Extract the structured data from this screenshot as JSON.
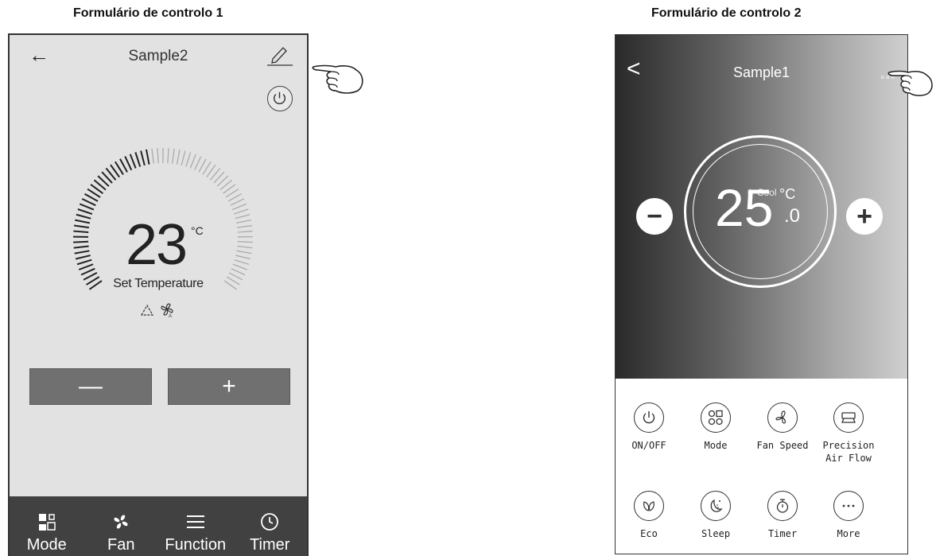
{
  "captions": {
    "form1": "Formulário de controlo 1",
    "form2": "Formulário de controlo 2"
  },
  "form1": {
    "title": "Sample2",
    "back_glyph": "←",
    "temperature": "23",
    "unit": "°C",
    "set_label": "Set Temperature",
    "minus_label": "—",
    "plus_label": "+",
    "nav": [
      {
        "label": "Mode",
        "icon": "mode-grid-icon"
      },
      {
        "label": "Fan",
        "icon": "fan-icon"
      },
      {
        "label": "Function",
        "icon": "menu-lines-icon"
      },
      {
        "label": "Timer",
        "icon": "clock-icon"
      }
    ],
    "colors": {
      "background": "#e2e2e2",
      "buttons": "#707070",
      "nav": "#414141"
    }
  },
  "form2": {
    "title": "Sample1",
    "back_glyph": "<",
    "more_glyph": "∘∘∘",
    "mode": "✳  Cool",
    "temperature": "25",
    "unit": "°C",
    "decimal": ".0",
    "minus_label": "−",
    "plus_label": "+",
    "controls": [
      {
        "label": "ON/OFF",
        "icon": "power-icon"
      },
      {
        "label": "Mode",
        "icon": "mode-icon"
      },
      {
        "label": "Fan Speed",
        "icon": "fan-speed-icon"
      },
      {
        "label": "Precision Air Flow",
        "icon": "air-flow-icon"
      },
      {
        "label": "Eco",
        "icon": "leaf-icon"
      },
      {
        "label": "Sleep",
        "icon": "moon-icon"
      },
      {
        "label": "Timer",
        "icon": "stopwatch-icon"
      },
      {
        "label": "More",
        "icon": "more-dots-icon"
      }
    ]
  }
}
